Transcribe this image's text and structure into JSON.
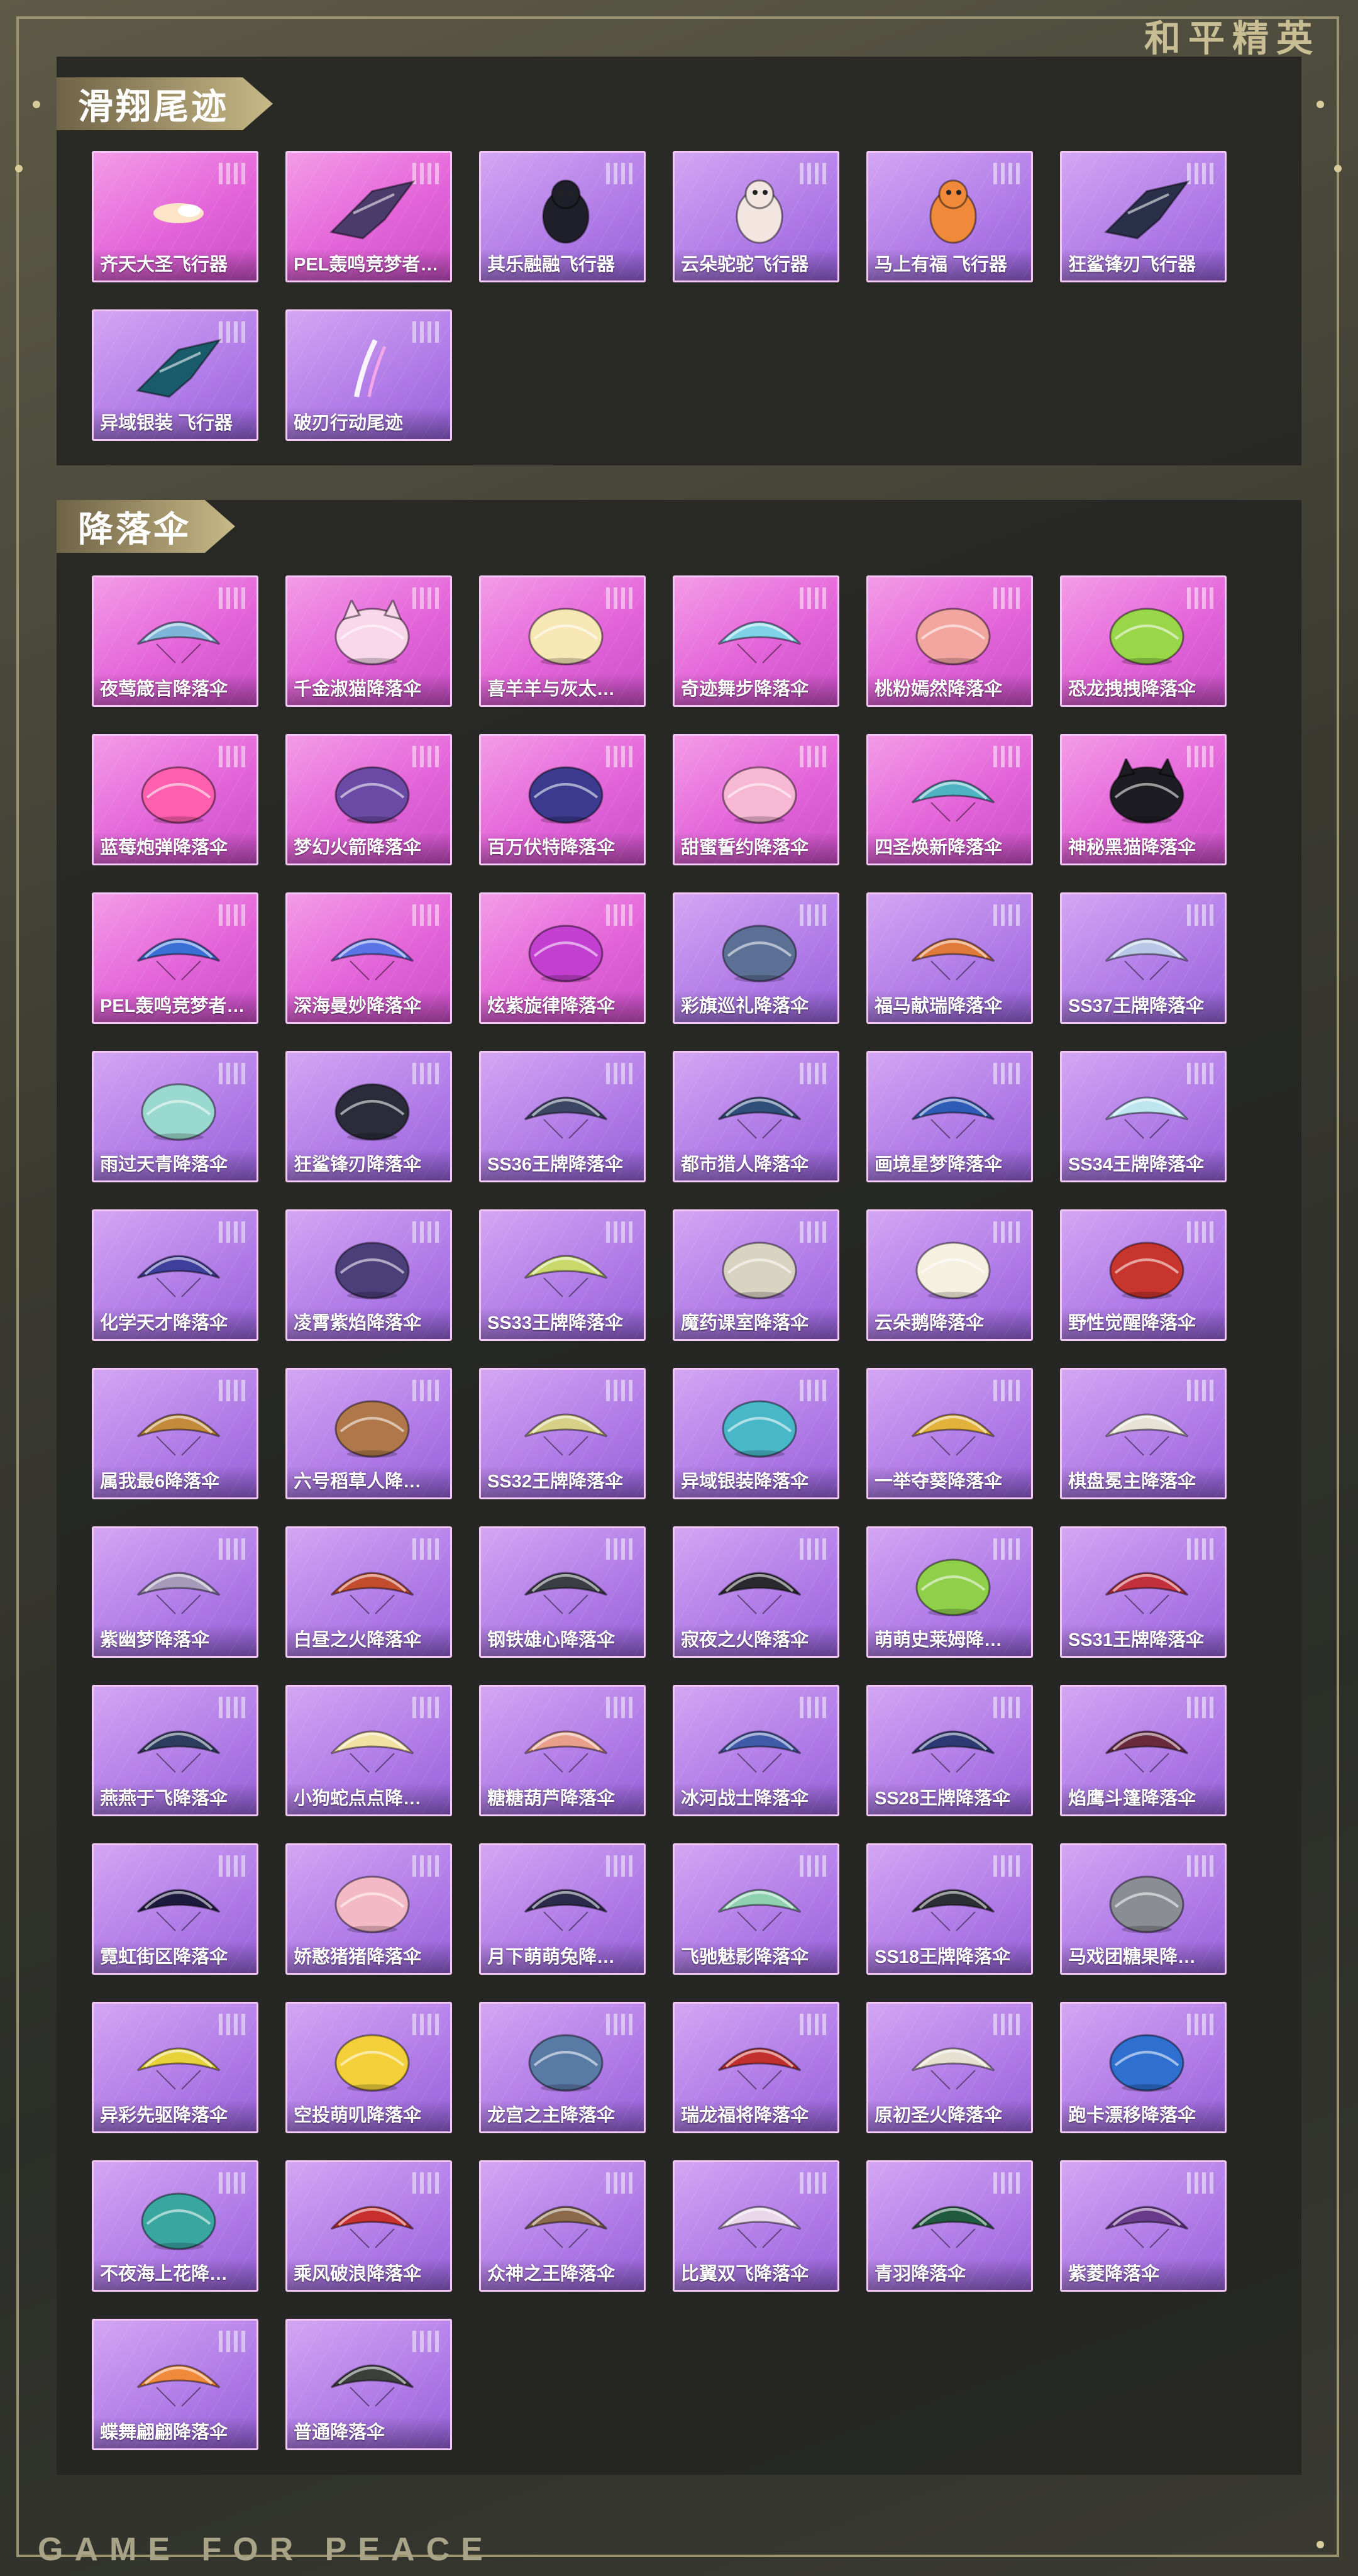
{
  "brand": {
    "cn": "和平精英",
    "en": "GAME FOR PEACE"
  },
  "glide": {
    "title": "滑翔尾迹",
    "items": [
      {
        "label": "齐天大圣飞行器",
        "icon": "flare-icon",
        "color": "#fff1c4",
        "quality": "pink"
      },
      {
        "label": "PEL轰鸣竞梦者…",
        "icon": "aircraft-icon",
        "color": "#4a3b6b",
        "quality": "pink"
      },
      {
        "label": "其乐融融飞行器",
        "icon": "penguin-icon",
        "color": "#1f1f2a",
        "quality": "purple"
      },
      {
        "label": "云朵驼驼飞行器",
        "icon": "alpaca-icon",
        "color": "#f3e6e1",
        "quality": "purple"
      },
      {
        "label": "马上有福 飞行器",
        "icon": "pony-icon",
        "color": "#f08a3a",
        "quality": "purple"
      },
      {
        "label": "狂鲨锋刃飞行器",
        "icon": "shark-jet-icon",
        "color": "#2a2f4a",
        "quality": "purple"
      },
      {
        "label": "异域银装 飞行器",
        "icon": "dragon-jet-icon",
        "color": "#1a5b6b",
        "quality": "purple"
      },
      {
        "label": "破刃行动尾迹",
        "icon": "trail-icon",
        "color": "#ffffff",
        "quality": "purple"
      }
    ]
  },
  "parachute": {
    "title": "降落伞",
    "items": [
      {
        "label": "夜莺箴言降落伞",
        "icon": "canopy-icon",
        "color": "#7fb5d8",
        "quality": "pink"
      },
      {
        "label": "千金淑猫降落伞",
        "icon": "cat-face-icon",
        "color": "#f8d7ea",
        "quality": "pink"
      },
      {
        "label": "喜羊羊与灰太…",
        "icon": "sheep-icon",
        "color": "#f6e7b5",
        "quality": "pink"
      },
      {
        "label": "奇迹舞步降落伞",
        "icon": "canopy-icon",
        "color": "#7ed3e6",
        "quality": "pink"
      },
      {
        "label": "桃粉嫣然降落伞",
        "icon": "round-chute-icon",
        "color": "#f3a6a0",
        "quality": "pink"
      },
      {
        "label": "恐龙拽拽降落伞",
        "icon": "dino-chute-icon",
        "color": "#9ad64a",
        "quality": "pink"
      },
      {
        "label": "蓝莓炮弹降落伞",
        "icon": "round-chute-icon",
        "color": "#ff5fae",
        "quality": "pink"
      },
      {
        "label": "梦幻火箭降落伞",
        "icon": "round-chute-icon",
        "color": "#6b4aa6",
        "quality": "pink"
      },
      {
        "label": "百万伏特降落伞",
        "icon": "round-chute-icon",
        "color": "#3b3a8f",
        "quality": "pink"
      },
      {
        "label": "甜蜜誓约降落伞",
        "icon": "round-chute-icon",
        "color": "#f7b8d3",
        "quality": "pink"
      },
      {
        "label": "四圣焕新降落伞",
        "icon": "canopy-icon",
        "color": "#4fb3c3",
        "quality": "pink"
      },
      {
        "label": "神秘黑猫降落伞",
        "icon": "black-cat-icon",
        "color": "#1c1c22",
        "quality": "pink"
      },
      {
        "label": "PEL轰鸣竞梦者…",
        "icon": "canopy-icon",
        "color": "#3a6fd6",
        "quality": "pink"
      },
      {
        "label": "深海曼妙降落伞",
        "icon": "canopy-icon",
        "color": "#5a74e6",
        "quality": "pink"
      },
      {
        "label": "炫紫旋律降落伞",
        "icon": "round-chute-icon",
        "color": "#c23fd0",
        "quality": "pink"
      },
      {
        "label": "彩旗巡礼降落伞",
        "icon": "round-chute-icon",
        "color": "#5c6f94",
        "quality": "purple"
      },
      {
        "label": "福马献瑞降落伞",
        "icon": "canopy-icon",
        "color": "#e07a3a",
        "quality": "purple"
      },
      {
        "label": "SS37王牌降落伞",
        "icon": "canopy-icon",
        "color": "#b9c7e6",
        "quality": "purple"
      },
      {
        "label": "雨过天青降落伞",
        "icon": "round-chute-icon",
        "color": "#9ad9cf",
        "quality": "purple"
      },
      {
        "label": "狂鲨锋刃降落伞",
        "icon": "round-chute-icon",
        "color": "#2a2c3a",
        "quality": "purple"
      },
      {
        "label": "SS36王牌降落伞",
        "icon": "canopy-icon",
        "color": "#3b4663",
        "quality": "purple"
      },
      {
        "label": "都市猎人降落伞",
        "icon": "canopy-icon",
        "color": "#2f4f7a",
        "quality": "purple"
      },
      {
        "label": "画境星梦降落伞",
        "icon": "canopy-icon",
        "color": "#2e5bb5",
        "quality": "purple"
      },
      {
        "label": "SS34王牌降落伞",
        "icon": "canopy-icon",
        "color": "#bde5ef",
        "quality": "purple"
      },
      {
        "label": "化学天才降落伞",
        "icon": "canopy-icon",
        "color": "#3e3f9c",
        "quality": "purple"
      },
      {
        "label": "凌霄紫焰降落伞",
        "icon": "round-chute-icon",
        "color": "#4b3f7a",
        "quality": "purple"
      },
      {
        "label": "SS33王牌降落伞",
        "icon": "canopy-icon",
        "color": "#c8d96a",
        "quality": "purple"
      },
      {
        "label": "魔药课室降落伞",
        "icon": "round-chute-icon",
        "color": "#d9d3c2",
        "quality": "purple"
      },
      {
        "label": "云朵鹅降落伞",
        "icon": "goose-icon",
        "color": "#f6f0e0",
        "quality": "purple"
      },
      {
        "label": "野性觉醒降落伞",
        "icon": "round-chute-icon",
        "color": "#c8342e",
        "quality": "purple"
      },
      {
        "label": "属我最6降落伞",
        "icon": "canopy-icon",
        "color": "#c28a3a",
        "quality": "purple"
      },
      {
        "label": "六号稻草人降…",
        "icon": "round-chute-icon",
        "color": "#b0784a",
        "quality": "purple"
      },
      {
        "label": "SS32王牌降落伞",
        "icon": "canopy-icon",
        "color": "#d8d086",
        "quality": "purple"
      },
      {
        "label": "异域银装降落伞",
        "icon": "round-chute-icon",
        "color": "#48b8c8",
        "quality": "purple"
      },
      {
        "label": "一举夺葵降落伞",
        "icon": "canopy-icon",
        "color": "#e3b23a",
        "quality": "purple"
      },
      {
        "label": "棋盘冕主降落伞",
        "icon": "canopy-icon",
        "color": "#e7e2d5",
        "quality": "purple"
      },
      {
        "label": "紫幽梦降落伞",
        "icon": "canopy-icon",
        "color": "#a59ab9",
        "quality": "purple"
      },
      {
        "label": "白昼之火降落伞",
        "icon": "canopy-icon",
        "color": "#c24c2e",
        "quality": "purple"
      },
      {
        "label": "钢铁雄心降落伞",
        "icon": "canopy-icon",
        "color": "#3a3e44",
        "quality": "purple"
      },
      {
        "label": "寂夜之火降落伞",
        "icon": "canopy-icon",
        "color": "#2a2a2e",
        "quality": "purple"
      },
      {
        "label": "萌萌史莱姆降…",
        "icon": "slime-icon",
        "color": "#8fcf4a",
        "quality": "purple"
      },
      {
        "label": "SS31王牌降落伞",
        "icon": "canopy-icon",
        "color": "#c2303e",
        "quality": "purple"
      },
      {
        "label": "燕燕于飞降落伞",
        "icon": "canopy-icon",
        "color": "#2c3c5e",
        "quality": "purple"
      },
      {
        "label": "小狗蛇点点降…",
        "icon": "canopy-icon",
        "color": "#f3e0a3",
        "quality": "purple"
      },
      {
        "label": "糖糖葫芦降落伞",
        "icon": "canopy-icon",
        "color": "#e8a08a",
        "quality": "purple"
      },
      {
        "label": "冰河战士降落伞",
        "icon": "canopy-icon",
        "color": "#3e5aa8",
        "quality": "purple"
      },
      {
        "label": "SS28王牌降落伞",
        "icon": "canopy-icon",
        "color": "#2b3a73",
        "quality": "purple"
      },
      {
        "label": "焰鹰斗篷降落伞",
        "icon": "canopy-icon",
        "color": "#6a2a3e",
        "quality": "purple"
      },
      {
        "label": "霓虹街区降落伞",
        "icon": "canopy-icon",
        "color": "#1e1a3e",
        "quality": "purple"
      },
      {
        "label": "娇憨猪猪降落伞",
        "icon": "round-chute-icon",
        "color": "#f4b9c6",
        "quality": "purple"
      },
      {
        "label": "月下萌萌兔降…",
        "icon": "canopy-icon",
        "color": "#2c2a4a",
        "quality": "purple"
      },
      {
        "label": "飞驰魅影降落伞",
        "icon": "canopy-icon",
        "color": "#8ed0b0",
        "quality": "purple"
      },
      {
        "label": "SS18王牌降落伞",
        "icon": "canopy-icon",
        "color": "#2d2e33",
        "quality": "purple"
      },
      {
        "label": "马戏团糖果降…",
        "icon": "round-chute-icon",
        "color": "#8a8d93",
        "quality": "purple"
      },
      {
        "label": "异彩先驱降落伞",
        "icon": "canopy-icon",
        "color": "#e7d23a",
        "quality": "purple"
      },
      {
        "label": "空投萌叽降落伞",
        "icon": "round-chute-icon",
        "color": "#f3d03a",
        "quality": "purple"
      },
      {
        "label": "龙宫之主降落伞",
        "icon": "round-chute-icon",
        "color": "#5a7aa6",
        "quality": "purple"
      },
      {
        "label": "瑞龙福将降落伞",
        "icon": "canopy-icon",
        "color": "#c2302e",
        "quality": "purple"
      },
      {
        "label": "原初圣火降落伞",
        "icon": "canopy-icon",
        "color": "#e6e0d0",
        "quality": "purple"
      },
      {
        "label": "跑卡漂移降落伞",
        "icon": "round-chute-icon",
        "color": "#2e6fd0",
        "quality": "purple"
      },
      {
        "label": "不夜海上花降…",
        "icon": "round-chute-icon",
        "color": "#3aa6a0",
        "quality": "purple"
      },
      {
        "label": "乘风破浪降落伞",
        "icon": "canopy-icon",
        "color": "#c8302e",
        "quality": "purple"
      },
      {
        "label": "众神之王降落伞",
        "icon": "canopy-icon",
        "color": "#8a6a4a",
        "quality": "purple"
      },
      {
        "label": "比翼双飞降落伞",
        "icon": "canopy-icon",
        "color": "#e8d8ea",
        "quality": "purple"
      },
      {
        "label": "青羽降落伞",
        "icon": "canopy-icon",
        "color": "#1f5a3e",
        "quality": "purple"
      },
      {
        "label": "紫菱降落伞",
        "icon": "canopy-icon",
        "color": "#6a3a8a",
        "quality": "purple"
      },
      {
        "label": "蝶舞翩翩降落伞",
        "icon": "canopy-icon",
        "color": "#f08a3a",
        "quality": "purple"
      },
      {
        "label": "普通降落伞",
        "icon": "canopy-icon",
        "color": "#3a3f3a",
        "quality": "purple"
      }
    ]
  }
}
